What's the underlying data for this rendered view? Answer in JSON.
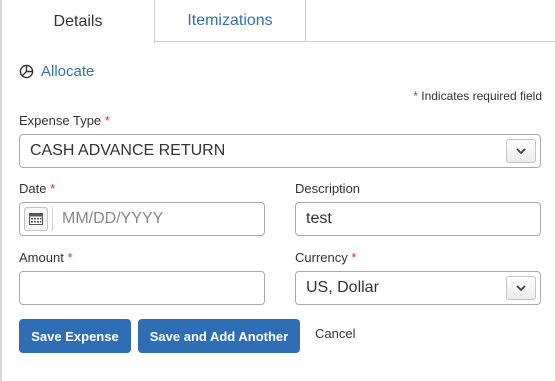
{
  "tabs": [
    {
      "label": "Details"
    },
    {
      "label": "Itemizations"
    }
  ],
  "allocate": {
    "label": "Allocate"
  },
  "required_note": {
    "star": "*",
    "text": "Indicates required field"
  },
  "expense_type": {
    "label": "Expense Type",
    "required": "*",
    "value": "CASH ADVANCE RETURN"
  },
  "date": {
    "label": "Date",
    "required": "*",
    "placeholder": "MM/DD/YYYY"
  },
  "description": {
    "label": "Description",
    "value": "test"
  },
  "amount": {
    "label": "Amount",
    "required": "*",
    "value": ""
  },
  "currency": {
    "label": "Currency",
    "required": "*",
    "value": "US, Dollar"
  },
  "actions": {
    "save": "Save Expense",
    "save_add": "Save and Add Another",
    "cancel": "Cancel"
  },
  "colors": {
    "accent": "#2f6db5",
    "link": "#3a6fb0",
    "required": "#d9302c"
  }
}
